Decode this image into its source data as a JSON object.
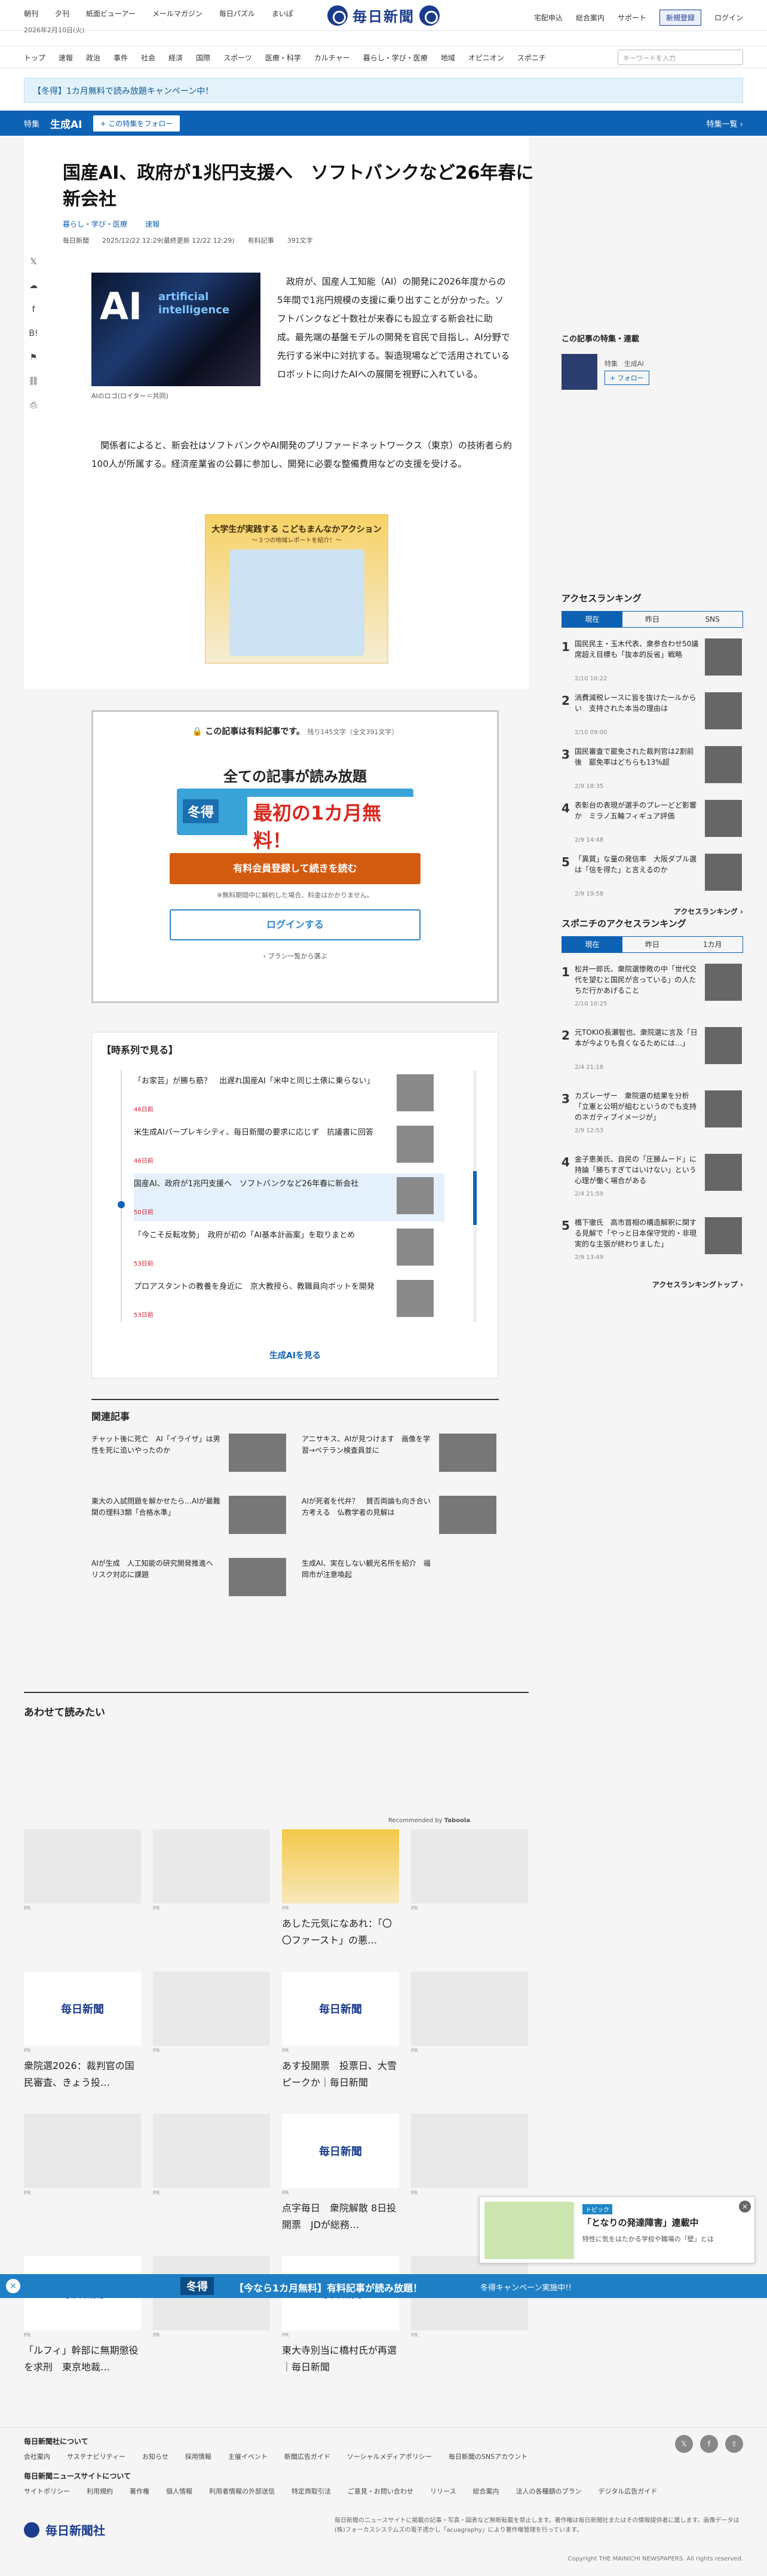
{
  "top": {
    "links": [
      "朝刊",
      "夕刊",
      "紙面ビューアー",
      "メールマガジン",
      "毎日パズル",
      "まいぽ"
    ],
    "date": "2026年2月10日(火)",
    "logo": "毎日新聞",
    "right": [
      "宅配申込",
      "総合案内",
      "サポート"
    ],
    "register": "新規登録",
    "login": "ログイン"
  },
  "nav": {
    "items": [
      "トップ",
      "速報",
      "政治",
      "事件",
      "社会",
      "経済",
      "国際",
      "スポーツ",
      "医療・科学",
      "カルチャー",
      "暮らし・学び・医療",
      "地域",
      "オピニオン",
      "スポニチ"
    ],
    "search_placeholder": "キーワードを入力"
  },
  "campaign": "【冬得】1カ月無料で読み放題キャンペーン中！",
  "feature": {
    "tag": "特集",
    "title": "生成AI",
    "follow": "+ この特集をフォロー",
    "more": "特集一覧 ›"
  },
  "article": {
    "title": "国産AI、政府が1兆円支援へ　ソフトバンクなど26年春に新会社",
    "subs": [
      "暮らし・学び・医療",
      "速報"
    ],
    "source": "毎日新聞",
    "datetime": "2025/12/22 12:29(最終更新 12/22 12:29)",
    "paid": "有料記事",
    "chars": "391文字",
    "photo_main": "AI",
    "photo_sub": "artificial intelligence",
    "caption": "AIのロゴ(ロイター＝共同)",
    "lead": "政府が、国産人工知能（AI）の開発に2026年度からの5年間で1兆円規模の支援に乗り出すことが分かった。ソフトバンクなど十数社が来春にも設立する新会社に助成。最先端の基盤モデルの開発を官民で目指し、AI分野で先行する米中に対抗する。製造現場などで活用されているロボットに向けたAIへの展開を視野に入れている。",
    "body": "関係者によると、新会社はソフトバンクやAI開発のプリファードネットワークス（東京）の技術者ら約100人が所属する。経済産業省の公募に参加し、開発に必要な整備費用などの支援を受ける。"
  },
  "ad": {
    "headline": "大学生が実践する こどもまんなかアクション",
    "sub": "～３つの地域レポートを紹介！～"
  },
  "paywall": {
    "lock": "この記事は有料記事です。",
    "remain": "残り145文字（全文391文字）",
    "headline": "全ての記事が読み放題",
    "banner_left": "冬得",
    "banner_right": "最初の1カ月無料！",
    "cta": "有料会員登録して続きを読む",
    "note": "※無料期間中に解約した場合、料金はかかりません。",
    "login": "ログインする",
    "plan": "› プラン一覧から選ぶ"
  },
  "series": {
    "heading": "【時系列で見る】",
    "items": [
      {
        "title": "「お家芸」が勝ち筋？　出遅れ国産AI「米中と同じ土俵に乗らない」",
        "date": "46日前"
      },
      {
        "title": "米生成AIパープレキシティ、毎日新聞の要求に応じず　抗議書に回答",
        "date": "46日前"
      },
      {
        "title": "国産AI、政府が1兆円支援へ　ソフトバンクなど26年春に新会社",
        "date": "50日前"
      },
      {
        "title": "「今こそ反転攻勢」　政府が初の「AI基本計画案」を取りまとめ",
        "date": "53日前"
      },
      {
        "title": "プロアスタントの教養を身近に　京大教授ら、教職員向ボットを開発",
        "date": "53日前"
      }
    ],
    "more": "生成AIを見る"
  },
  "related": {
    "heading": "関連記事",
    "items": [
      "チャット後に死亡　AI「イライザ」は男性を死に追いやったのか",
      "アニサキス、AIが見つけます　画像を学習→ペテラン検査員並に",
      "東大の入試問題を解かせたら…AIが最難関の理科3類「合格水準」",
      "AIが死者を代弁？　賛否両論も向き合い方考える　仏教学者の見解は",
      "AIが生成　人工知能の研究開発推進へ　リスク対応に課題",
      "生成AI、実在しない観光名所を紹介　福岡市が注意喚起"
    ]
  },
  "alsoread": {
    "heading": "あわせて読みたい",
    "recommended": "Recommended by",
    "tiles": [
      "あした元気になあれ：「〇〇ファースト」の悪…",
      "衆院選2026：裁判官の国民審査、きょう投…",
      "あす投開票　投票日、大雪ピークか｜毎日新聞",
      "点字毎日　衆院解散 8日投開票　JDが総務…",
      "「ルフィ」幹部に無期懲役を求刑　東京地裁…",
      "東大寺別当に橋村氏が再選｜毎日新聞"
    ],
    "pr": "PR"
  },
  "sidebar": {
    "feature_heading": "この記事の特集・連載",
    "feature_tag": "特集　生成AI",
    "follow": "+ フォロー"
  },
  "ranking": {
    "heading": "アクセスランキング",
    "tabs": [
      "現在",
      "昨日",
      "SNS"
    ],
    "items": [
      {
        "t": "国民民主・玉木代表、衆参合わせ50議席超え目標も「抜本的反省」戦略",
        "d": "2/10 10:22"
      },
      {
        "t": "消費減税レースに皆を抜けた一ルからい　支持された本当の理由は",
        "d": "2/10 09:00"
      },
      {
        "t": "国民審査で罷免された裁判官は2割前後　罷免率はどちらも13%超",
        "d": "2/9 18:35"
      },
      {
        "t": "表彰台の表現が選手のプレーどど影響か　ミラノ五輪フィギュア評価",
        "d": "2/9 14:48"
      },
      {
        "t": "「異質」な量の発信率　大阪ダブル選は「信を得た」と言えるのか",
        "d": "2/9 19:58"
      }
    ],
    "more": "アクセスランキング ›"
  },
  "sponichi": {
    "heading": "スポニチのアクセスランキング",
    "tabs": [
      "現在",
      "昨日",
      "1カ月"
    ],
    "items": [
      {
        "t": "松井一郎氏、衆院選惨敗の中「世代交代を望むと国民が言っている」の人たちだ行かあげること",
        "d": "2/10 10:25"
      },
      {
        "t": "元TOKIO長瀬智也、衆院選に言及「日本が今よりも良くなるためには…」",
        "d": "2/4 21:18"
      },
      {
        "t": "カズレーザー　衆院選の結果を分析「立憲と公明が組むというのでも支持のネガティブイメージが」",
        "d": "2/9 12:53"
      },
      {
        "t": "金子恵美氏、自民の「圧勝ムード」に持論「勝ちすぎてはいけない」という心理が働く場合がある",
        "d": "2/4 21:59"
      },
      {
        "t": "橋下徹氏　高市首相の構造解釈に関する見解で「やっと日本保守党的・非現実的な主張が終わりました」",
        "d": "2/9 13:49"
      }
    ],
    "more": "アクセスランキングトップ ›"
  },
  "popup": {
    "tag": "トピック",
    "title": "「となりの発達障害」連載中",
    "sub": "特性に気をはたかる学校や職場の「壁」とは"
  },
  "bottom": {
    "winter": "冬得",
    "text": "【今なら1カ月無料】有料記事が読み放題！",
    "cta": "冬得キャンペーン実施中!!"
  },
  "footer": {
    "about": "毎日新聞社について",
    "about_links": [
      "会社案内",
      "サステナビリティー",
      "お知らせ",
      "採用情報",
      "主催イベント",
      "新聞広告ガイド",
      "ソーシャルメディアポリシー",
      "毎日新聞のSNSアカウント"
    ],
    "site": "毎日新聞ニュースサイトについて",
    "site_links": [
      "サイトポリシー",
      "利用規約",
      "著作権",
      "個人情報",
      "利用者情報の外部送信",
      "特定商取引法",
      "ご意見・お問い合わせ",
      "リリース",
      "総合案内",
      "法人の各種額のプラン",
      "デジタル広告ガイド"
    ],
    "logo": "毎日新聞社",
    "desc": "毎日新聞のニュースサイトに掲載の記事・写真・図表など無断転載を禁止します。著作権は毎日新聞社またはその情報提供者に属します。画像データは(株)フォーカスシステムズの電子透かし「acuagraphy」により著作権管理を行っています。",
    "copyright": "Copyright THE MAINICHI NEWSPAPERS. All rights reserved."
  }
}
